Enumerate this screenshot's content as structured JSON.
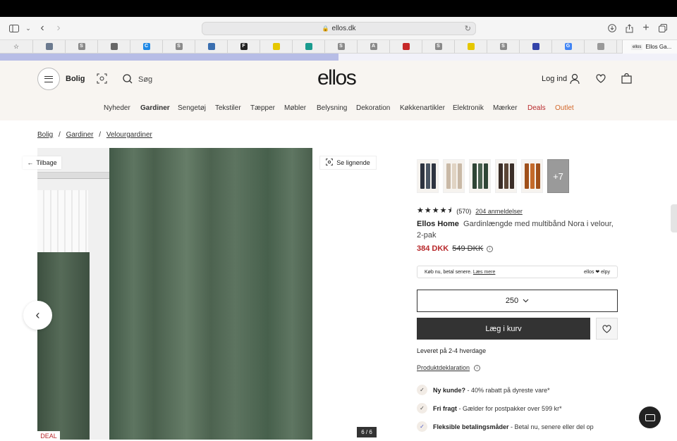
{
  "browser": {
    "url": "ellos.dk",
    "last_tab_label": "Ellos Ga..."
  },
  "bookmarks": [
    {
      "icon": "photo-icon",
      "letter": ""
    },
    {
      "icon": "s-icon",
      "letter": "S"
    },
    {
      "icon": "swirl-icon",
      "letter": ""
    },
    {
      "icon": "c-icon",
      "letter": "C"
    },
    {
      "icon": "s-icon",
      "letter": "S"
    },
    {
      "icon": "drop-icon",
      "letter": ""
    },
    {
      "icon": "f-icon",
      "letter": "F"
    },
    {
      "icon": "smile-icon",
      "letter": ""
    },
    {
      "icon": "globe-icon",
      "letter": ""
    },
    {
      "icon": "s-icon",
      "letter": "S"
    },
    {
      "icon": "a-icon",
      "letter": "A"
    },
    {
      "icon": "pin-icon",
      "letter": ""
    },
    {
      "icon": "s-icon",
      "letter": "S"
    },
    {
      "icon": "smile-icon",
      "letter": ""
    },
    {
      "icon": "s-icon",
      "letter": "S"
    },
    {
      "icon": "ellos-icon",
      "letter": ""
    },
    {
      "icon": "google-icon",
      "letter": "G"
    },
    {
      "icon": "ellos-icon",
      "letter": ""
    }
  ],
  "load_progress": 0.5,
  "header": {
    "category_label": "Bolig",
    "search_label": "Søg",
    "logo": "ellos",
    "login_label": "Log ind"
  },
  "nav": [
    "Nyheder",
    "Gardiner",
    "Sengetøj",
    "Tekstiler",
    "Tæpper",
    "Møbler",
    "Belysning",
    "Dekoration",
    "Køkkenartikler",
    "Elektronik",
    "Mærker",
    "Deals",
    "Outlet"
  ],
  "breadcrumb": [
    "Bolig",
    "Gardiner",
    "Velourgardiner"
  ],
  "gallery": {
    "back_label": "Tilbage",
    "similar_label": "Se lignende",
    "deal_label": "DEAL",
    "counter": "6 / 6"
  },
  "swatches": {
    "colors": [
      [
        "#2e3440",
        "#4a5563"
      ],
      [
        "#c9b9a6",
        "#e0d3c3"
      ],
      [
        "#2f4535",
        "#49614f"
      ],
      [
        "#3b2e27",
        "#5b4636"
      ],
      [
        "#a0501a",
        "#c46a2a"
      ]
    ],
    "more_label": "+7"
  },
  "product": {
    "rating_value": 4.5,
    "review_count": "(570)",
    "reviews_link": "204 anmeldelser",
    "brand": "Ellos Home",
    "name": "Gardinlængde med multibånd Nora i velour, 2-pak",
    "price_now": "384 DKK",
    "price_old": "549 DKK",
    "klarna_text": "Køb nu, betal senere.",
    "klarna_link": "Læs mere",
    "klarna_brand": "ellos ❤ elpy",
    "size_selected": "250",
    "add_to_cart": "Læg i kurv",
    "delivery": "Leveret på 2-4 hverdage",
    "declaration_link": "Produktdeklaration"
  },
  "usps": [
    {
      "title": "Ny kunde?",
      "text": " - 40% rabatt på dyreste vare*"
    },
    {
      "title": "Fri fragt",
      "text": " - Gælder for postpakker over 599 kr*"
    },
    {
      "title": "Fleksible betalingsmåder",
      "text": " - Betal nu, senere eller del op"
    }
  ],
  "colors": {
    "accent_red": "#b8282b",
    "header_bg": "#f8f5f1",
    "button_dark": "#333333"
  }
}
